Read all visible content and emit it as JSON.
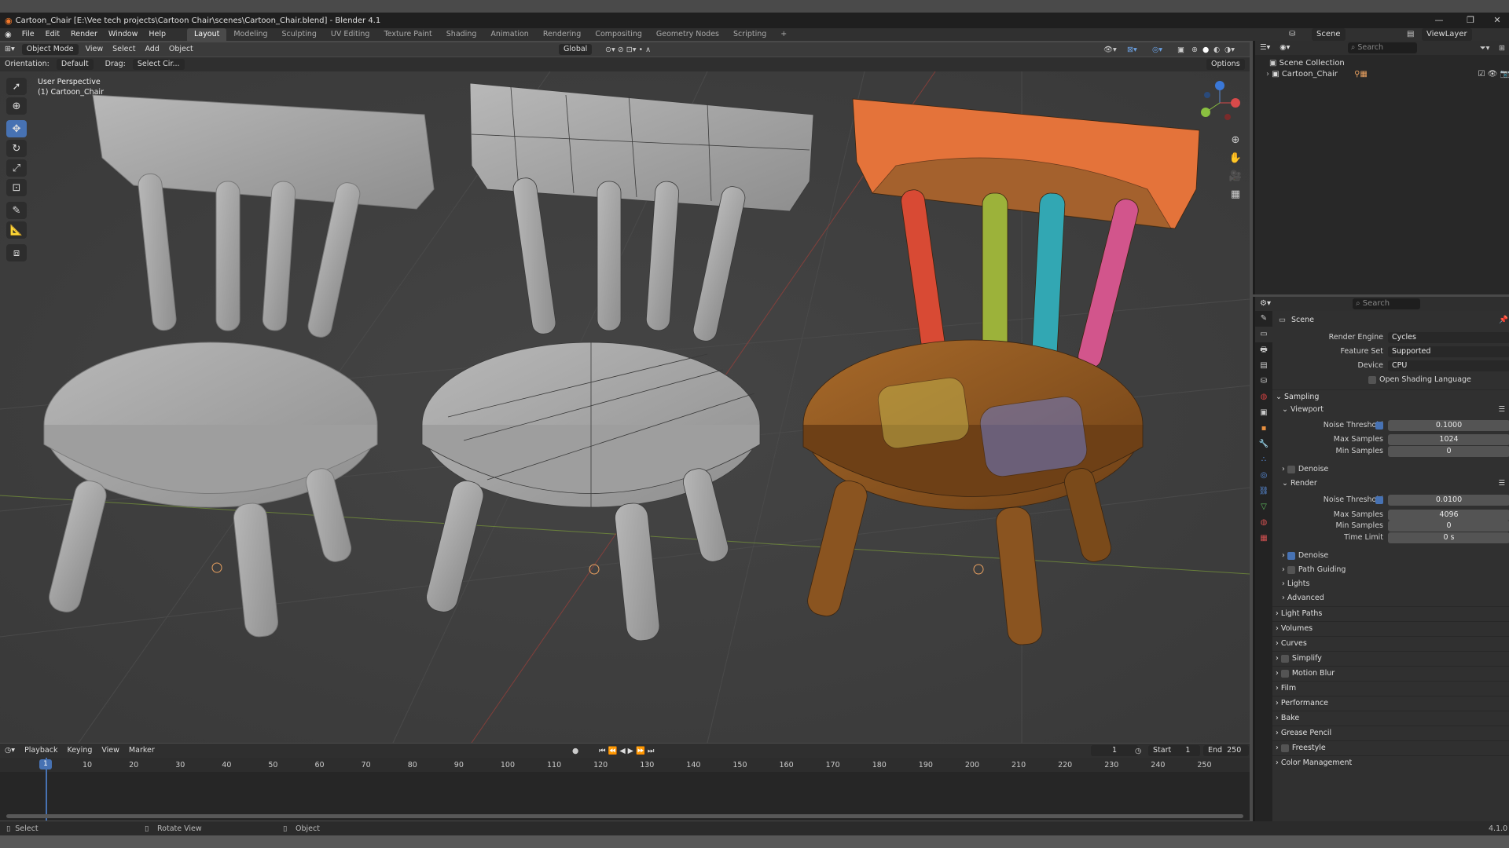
{
  "window": {
    "title": "Cartoon_Chair [E:\\Vee tech projects\\Cartoon Chair\\scenes\\Cartoon_Chair.blend] - Blender 4.1"
  },
  "menu": {
    "items": [
      "File",
      "Edit",
      "Render",
      "Window",
      "Help"
    ],
    "workspaces": [
      "Layout",
      "Modeling",
      "Sculpting",
      "UV Editing",
      "Texture Paint",
      "Shading",
      "Animation",
      "Rendering",
      "Compositing",
      "Geometry Nodes",
      "Scripting"
    ],
    "active_workspace": "Layout",
    "scene": "Scene",
    "view_layer": "ViewLayer"
  },
  "viewport_header": {
    "mode": "Object Mode",
    "menus": [
      "View",
      "Select",
      "Add",
      "Object"
    ],
    "transform": "Global",
    "orientation_label": "Orientation:",
    "orientation_value": "Default",
    "drag_label": "Drag:",
    "drag_value": "Select Cir...",
    "options": "Options"
  },
  "viewport": {
    "perspective": "User Perspective",
    "object": "(1) Cartoon_Chair"
  },
  "timeline": {
    "menus": [
      "Playback",
      "Keying",
      "View",
      "Marker"
    ],
    "current_frame": "1",
    "start_label": "Start",
    "start": "1",
    "end_label": "End",
    "end": "250",
    "ticks": [
      "1",
      "10",
      "20",
      "30",
      "40",
      "50",
      "60",
      "70",
      "80",
      "90",
      "100",
      "110",
      "120",
      "130",
      "140",
      "150",
      "160",
      "170",
      "180",
      "190",
      "200",
      "210",
      "220",
      "230",
      "240",
      "250"
    ]
  },
  "statusbar": {
    "select": "Select",
    "rotate": "Rotate View",
    "object": "Object",
    "version": "4.1.0"
  },
  "outliner": {
    "search_placeholder": "Search",
    "root": "Scene Collection",
    "items": [
      {
        "label": "Cartoon_Chair"
      }
    ]
  },
  "properties": {
    "search_placeholder": "Search",
    "context": "Scene",
    "render_engine_label": "Render Engine",
    "render_engine": "Cycles",
    "feature_set_label": "Feature Set",
    "feature_set": "Supported",
    "device_label": "Device",
    "device": "CPU",
    "osl": "Open Shading Language",
    "sampling": "Sampling",
    "viewport": "Viewport",
    "noise_threshold_label": "Noise Threshold",
    "vp_noise_threshold": "0.1000",
    "max_samples_label": "Max Samples",
    "vp_max_samples": "1024",
    "min_samples_label": "Min Samples",
    "vp_min_samples": "0",
    "denoise": "Denoise",
    "render": "Render",
    "r_noise_threshold": "0.0100",
    "r_max_samples": "4096",
    "r_min_samples": "0",
    "time_limit_label": "Time Limit",
    "time_limit": "0 s",
    "subsections": [
      "Path Guiding",
      "Lights",
      "Advanced"
    ],
    "panels": [
      "Light Paths",
      "Volumes",
      "Curves",
      "Simplify",
      "Motion Blur",
      "Film",
      "Performance",
      "Bake",
      "Grease Pencil",
      "Freestyle",
      "Color Management"
    ]
  },
  "colors": {
    "accent": "#4772b3",
    "playhead": "#4772b3"
  }
}
